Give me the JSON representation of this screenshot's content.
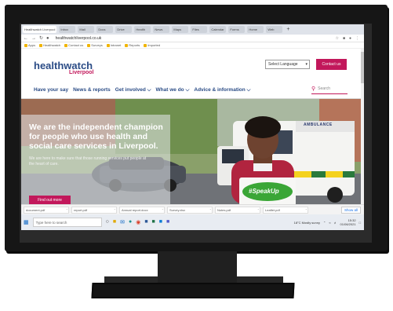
{
  "browser": {
    "tabs": [
      "Healthwatch Liverpool",
      "Inbox",
      "Mail",
      "Docs",
      "Drive",
      "Health",
      "News",
      "Maps",
      "Files",
      "Calendar",
      "Forms",
      "Home",
      "Web"
    ],
    "new_tab": "+",
    "url": "healthwatchliverpool.co.uk",
    "bookmarks": [
      "Apps",
      "Healthwatch",
      "Contact us",
      "Surveys",
      "Intranet",
      "Reports",
      "Imported"
    ]
  },
  "site": {
    "logo_main": "healthwatch",
    "logo_sub": "Liverpool",
    "language_select": "Select Language",
    "contact_button": "Contact us",
    "nav": [
      "Have your say",
      "News & reports",
      "Get involved ⌵",
      "What we do ⌵",
      "Advice & information ⌵"
    ],
    "search_placeholder": "Search"
  },
  "hero": {
    "title": "We are the independent champion for people who use health and social care services in Liverpool.",
    "subtitle": "We are here to make sure that those running services put people at the heart of care.",
    "button": "Find out more",
    "sign_text": "#SpeakUp",
    "ambulance_label": "AMBULANCE"
  },
  "downloads": {
    "items": [
      "document.pdf",
      "report.pdf",
      "Annual report.docx",
      "Survey.xlsx",
      "Notes.pdf",
      "Leaflet.pdf"
    ],
    "show_all": "Show all"
  },
  "taskbar": {
    "search_placeholder": "Type here to search",
    "time": "15:32",
    "date": "01/06/2021",
    "weather": "18°C Mostly sunny"
  },
  "colors": {
    "brand_blue": "#2b4c86",
    "brand_pink": "#c2185b",
    "sign_green": "#3aa636"
  }
}
